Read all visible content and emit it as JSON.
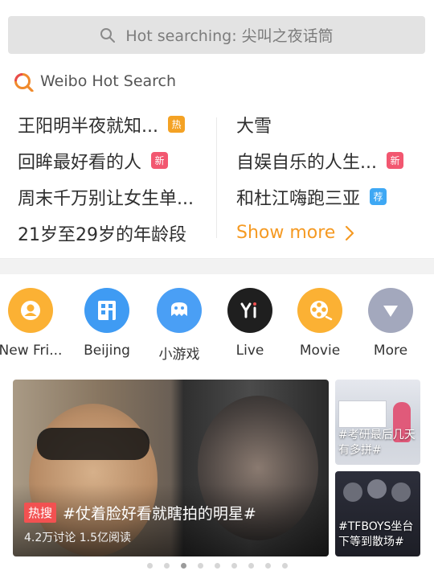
{
  "search": {
    "placeholder": "Hot searching: 尖叫之夜话筒"
  },
  "hot_search": {
    "title": "Weibo Hot Search",
    "left": [
      {
        "text": "王阳明半夜就知...",
        "badge": "热",
        "badge_type": "hot"
      },
      {
        "text": "回眸最好看的人",
        "badge": "新",
        "badge_type": "new"
      },
      {
        "text": "周末千万别让女生单...",
        "badge": "",
        "badge_type": ""
      },
      {
        "text": "21岁至29岁的年龄段",
        "badge": "",
        "badge_type": ""
      }
    ],
    "right": [
      {
        "text": "大雪",
        "badge": "",
        "badge_type": ""
      },
      {
        "text": "自娱自乐的人生...",
        "badge": "新",
        "badge_type": "new"
      },
      {
        "text": "和杜江嗨跑三亚",
        "badge": "荐",
        "badge_type": "rec"
      }
    ],
    "show_more": "Show more"
  },
  "apps": [
    {
      "label": "New Fri...",
      "icon": "new-friends-icon",
      "color": "#fbb134"
    },
    {
      "label": "Beijing",
      "icon": "building-icon",
      "color": "#3f9bf3"
    },
    {
      "label": "小游戏",
      "icon": "game-controller-icon",
      "color": "#4a9ff5"
    },
    {
      "label": "Live",
      "icon": "live-yi-icon",
      "color": "#1f1f1f"
    },
    {
      "label": "Movie",
      "icon": "film-reel-icon",
      "color": "#fbb134"
    },
    {
      "label": "More",
      "icon": "more-triangle-icon",
      "color": "#a3a8bd"
    }
  ],
  "feature": {
    "tag": "热搜",
    "headline": "#仗着脸好看就瞎拍的明星#",
    "stats": "4.2万讨论  1.5亿阅读"
  },
  "side_cards": [
    {
      "label": "#考研最后几天有多拼#"
    },
    {
      "label": "#TFBOYS坐台下等到散场#"
    }
  ],
  "carousel": {
    "count": 9,
    "active": 2
  },
  "colors": {
    "accent_orange": "#f59a23",
    "badge_hot": "#f4a224",
    "badge_new": "#f25770",
    "badge_rec": "#3ea8f4"
  }
}
